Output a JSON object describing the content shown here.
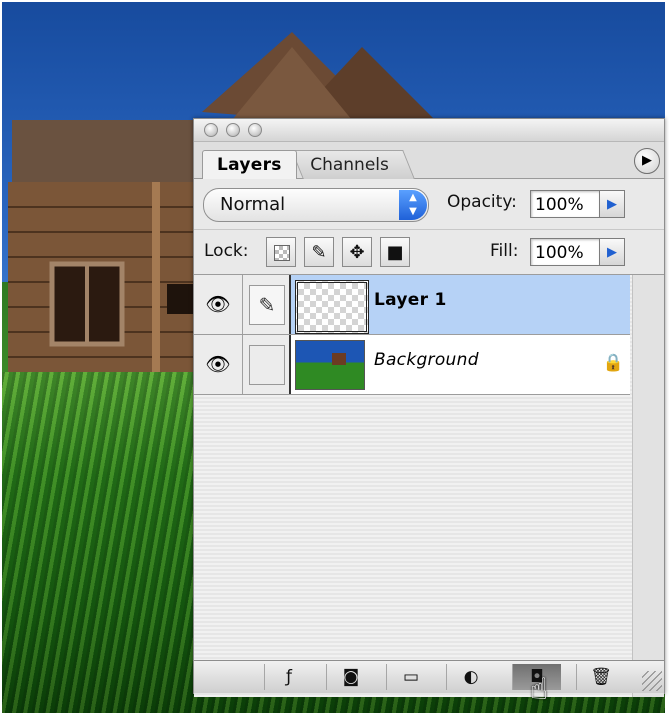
{
  "panel": {
    "tabs": [
      {
        "label": "Layers",
        "active": true
      },
      {
        "label": "Channels",
        "active": false
      }
    ],
    "menu_icon": "triangle-right-icon",
    "blend_mode": "Normal",
    "opacity_label": "Opacity:",
    "opacity_value": "100%",
    "lock_label": "Lock:",
    "fill_label": "Fill:",
    "fill_value": "100%",
    "lock_icons": [
      "lock-transparent-icon",
      "lock-paint-icon",
      "lock-move-icon",
      "lock-all-icon"
    ],
    "layers": [
      {
        "name": "Layer 1",
        "selected": true,
        "visible": true,
        "locked": false
      },
      {
        "name": "Background",
        "selected": false,
        "visible": true,
        "locked": true
      }
    ],
    "bottom_icons": [
      "layer-style-icon",
      "layer-mask-icon",
      "new-group-icon",
      "adjustment-layer-icon",
      "new-layer-icon",
      "trash-icon"
    ]
  },
  "colors": {
    "selection": "#b6d2f6",
    "accent_blue": "#1f61d8",
    "sky": "#2a66c0",
    "grass": "#2e7d1f"
  }
}
